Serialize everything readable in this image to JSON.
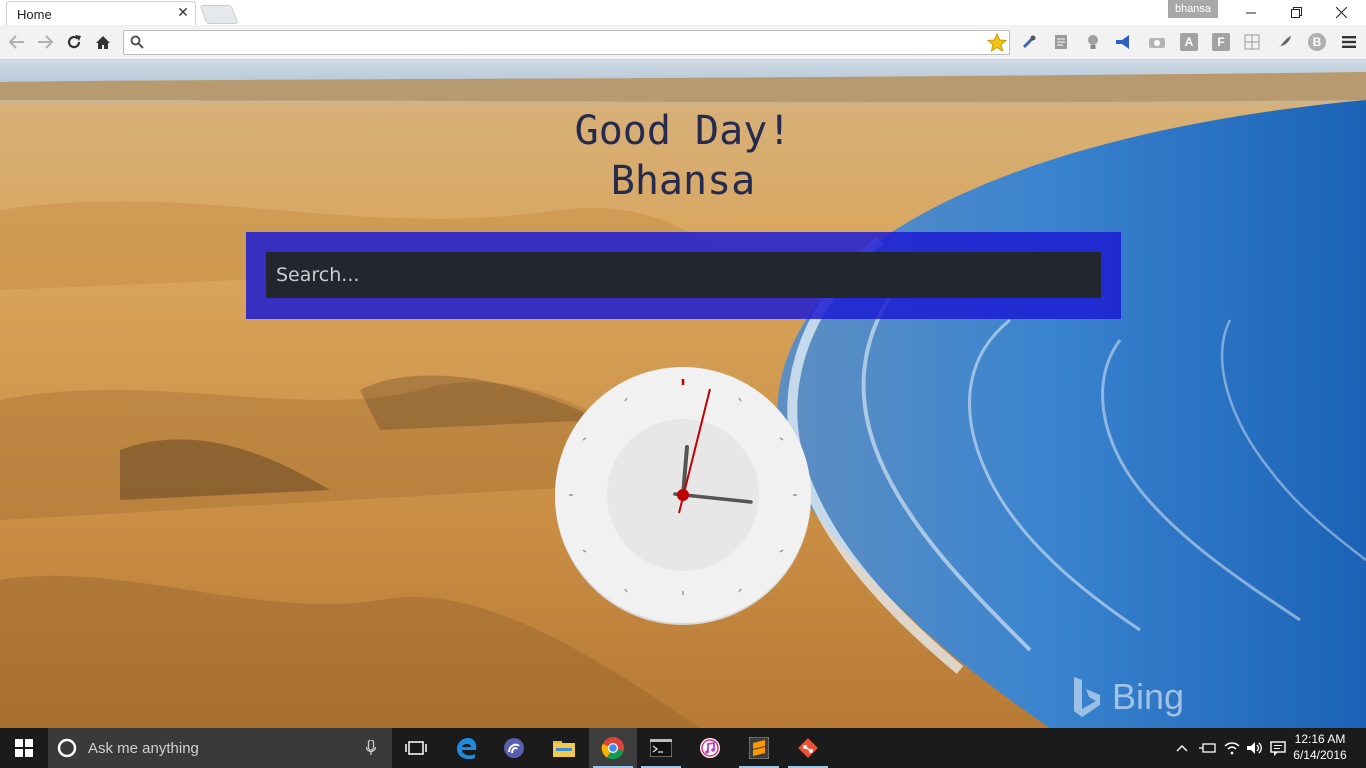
{
  "browser": {
    "tab_title": "Home",
    "profile_name": "bhansa",
    "omnibox_value": "",
    "star_color": "#f1c40f"
  },
  "page": {
    "greeting": "Good Day!",
    "user_name": "Bhansa",
    "search_placeholder": "Search...",
    "search_panel_color": "#1c1cd2",
    "watermark": "Bing",
    "clock_time": "12:16"
  },
  "taskbar": {
    "search_placeholder": "Ask me anything",
    "time": "12:16 AM",
    "date": "6/14/2016"
  },
  "icons": {
    "extensions": [
      "eyedropper-icon",
      "page-icon",
      "lightbulb-icon",
      "megaphone-icon",
      "camera-icon",
      "a-icon",
      "f-icon",
      "grid-icon",
      "feather-icon",
      "b-icon"
    ],
    "taskbar_apps": [
      "task-view-icon",
      "edge-icon",
      "torrent-icon",
      "file-explorer-icon",
      "chrome-icon",
      "terminal-icon",
      "itunes-icon",
      "sublime-icon",
      "git-icon"
    ]
  }
}
